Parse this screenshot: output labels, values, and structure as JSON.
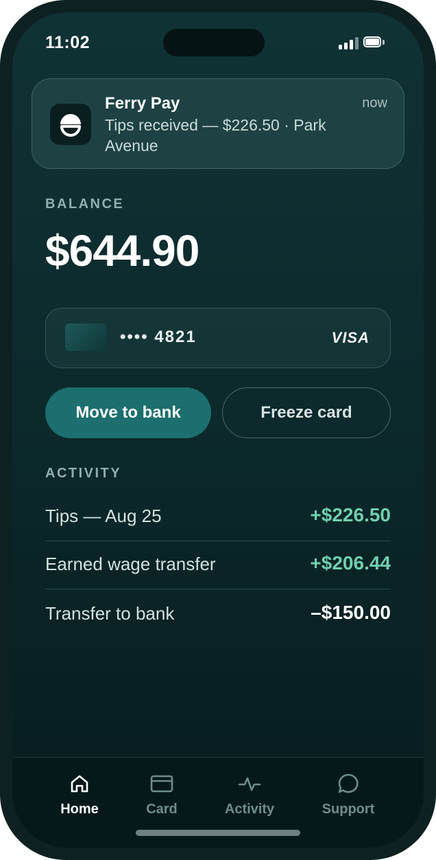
{
  "status_bar": {
    "time": "11:02"
  },
  "notification": {
    "app_name": "Ferry Pay",
    "time": "now",
    "message": "Tips received — $226.50 · Park Avenue",
    "icon": "ferry-pay-logo-icon"
  },
  "balance": {
    "label": "BALANCE",
    "amount": "$644.90"
  },
  "card": {
    "masked_number": "•••• 4821",
    "brand": "VISA"
  },
  "actions": {
    "move_to_bank": "Move to bank",
    "freeze_card": "Freeze card"
  },
  "activity": {
    "label": "ACTIVITY",
    "items": [
      {
        "description": "Tips — Aug 25",
        "amount": "+$226.50",
        "type": "credit"
      },
      {
        "description": "Earned wage transfer",
        "amount": "+$206.44",
        "type": "credit"
      },
      {
        "description": "Transfer to bank",
        "amount": "–$150.00",
        "type": "debit"
      }
    ]
  },
  "tabs": [
    {
      "label": "Home",
      "icon": "home-icon",
      "active": true
    },
    {
      "label": "Card",
      "icon": "card-icon",
      "active": false
    },
    {
      "label": "Activity",
      "icon": "activity-icon",
      "active": false
    },
    {
      "label": "Support",
      "icon": "chat-bubble-icon",
      "active": false
    }
  ],
  "colors": {
    "accent": "#1c6f6e",
    "positive": "#6fcfae",
    "background": "#0c2a2c"
  }
}
